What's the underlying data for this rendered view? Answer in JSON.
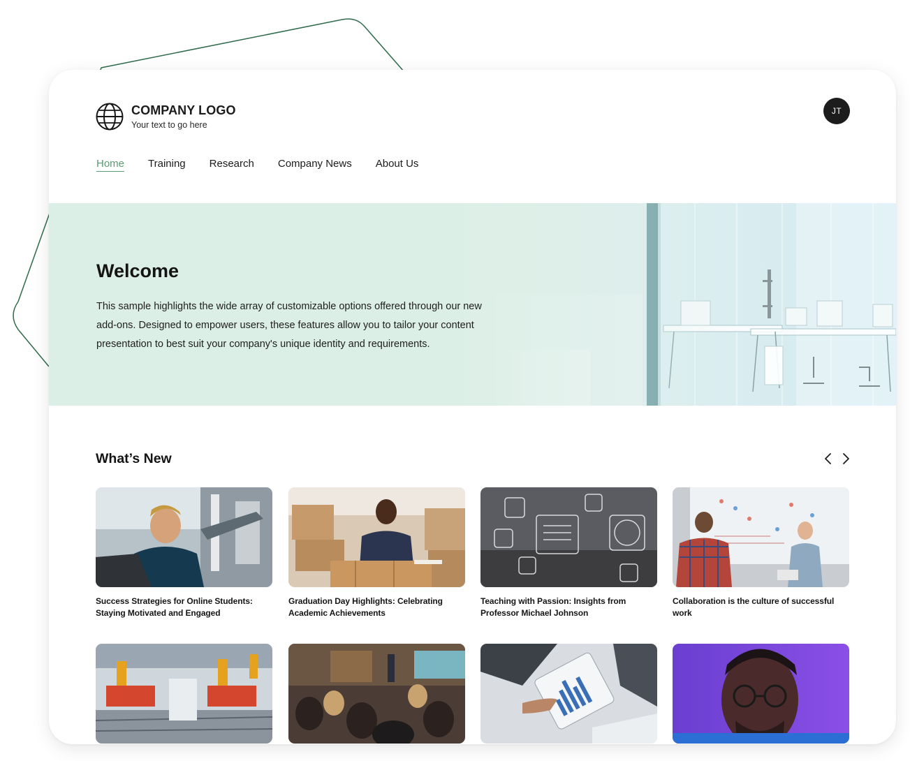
{
  "brand": {
    "name": "COMPANY LOGO",
    "tagline": "Your text to go here",
    "logo_icon": "globe-icon"
  },
  "user": {
    "initials": "JT"
  },
  "nav": {
    "items": [
      {
        "label": "Home",
        "active": true
      },
      {
        "label": "Training"
      },
      {
        "label": "Research"
      },
      {
        "label": "Company News"
      },
      {
        "label": "About Us"
      }
    ]
  },
  "hero": {
    "title": "Welcome",
    "body": "This sample highlights the wide array of customizable options offered through our new add-ons. Designed to empower users, these features allow you to tailor your content presentation to best suit your company's unique identity and requirements."
  },
  "whats_new": {
    "title": "What’s New",
    "prev_icon": "chevron-left-icon",
    "next_icon": "chevron-right-icon",
    "cards": [
      {
        "caption": "Success Strategies for Online Students: Staying Motivated and Engaged",
        "image": "engineer-with-laptop-photo"
      },
      {
        "caption": "Graduation Day Highlights: Celebrating Academic Achievements",
        "image": "warehouse-worker-photo"
      },
      {
        "caption": "Teaching with Passion: Insights from Professor Michael Johnson",
        "image": "e-learning-icons-photo"
      },
      {
        "caption": "Collaboration is the culture of successful work",
        "image": "whiteboard-meeting-photo"
      },
      {
        "caption": "",
        "image": "robotic-assembly-line-photo"
      },
      {
        "caption": "",
        "image": "lecture-audience-photo"
      },
      {
        "caption": "",
        "image": "tablet-analytics-photo"
      },
      {
        "caption": "",
        "image": "man-with-glasses-photo"
      }
    ]
  },
  "colors": {
    "accent": "#5a9a73",
    "deco_line": "#2e6b4c",
    "hero_tint": "#dcefe6"
  }
}
